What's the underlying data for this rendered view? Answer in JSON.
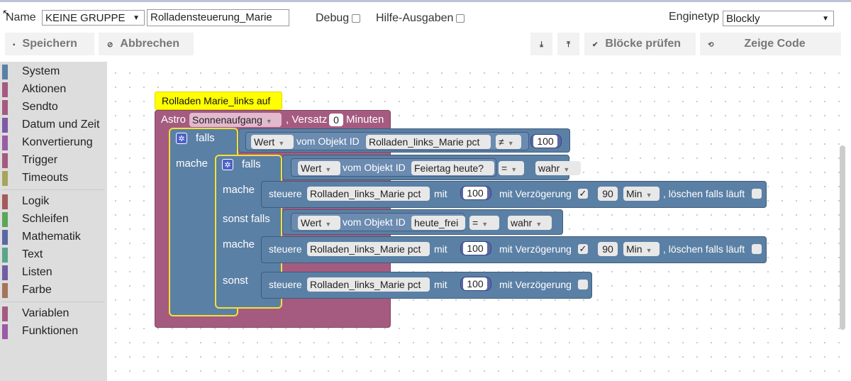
{
  "header": {
    "name_label": "Name",
    "group_select": "KEINE GRUPPE",
    "script_name": "Rolladensteuerung_Marie",
    "debug_label": "Debug",
    "help_label": "Hilfe-Ausgaben",
    "enginetype_label": "Enginetyp",
    "enginetype_value": "Blockly"
  },
  "toolbar": {
    "save_label": "Speichern",
    "cancel_label": "Abbrechen",
    "check_label": "Blöcke prüfen",
    "show_code_label": "Zeige Code"
  },
  "sidebar": {
    "items": [
      {
        "label": "System",
        "color": "#5b80a5"
      },
      {
        "label": "Aktionen",
        "color": "#a55b80"
      },
      {
        "label": "Sendto",
        "color": "#a55b80"
      },
      {
        "label": "Datum und Zeit",
        "color": "#7d5ba5"
      },
      {
        "label": "Konvertierung",
        "color": "#9a5ca6"
      },
      {
        "label": "Trigger",
        "color": "#a55b80"
      },
      {
        "label": "Timeouts",
        "color": "#a5a55b"
      },
      {
        "label": "Logik",
        "color": "#a55b5b"
      },
      {
        "label": "Schleifen",
        "color": "#5ba55b"
      },
      {
        "label": "Mathematik",
        "color": "#5b67a5"
      },
      {
        "label": "Text",
        "color": "#5ba58c"
      },
      {
        "label": "Listen",
        "color": "#745ba5"
      },
      {
        "label": "Farbe",
        "color": "#a5745b"
      },
      {
        "label": "Variablen",
        "color": "#a55b80"
      },
      {
        "label": "Funktionen",
        "color": "#995ba5"
      }
    ]
  },
  "blocks": {
    "comment": "Rolladen Marie_links auf",
    "astro_prefix": "Astro",
    "astro_event": "Sonnenaufgang",
    "astro_offset_label": ", Versatz",
    "astro_offset_value": "0",
    "astro_unit": "Minuten",
    "kw_if": "falls",
    "kw_do": "mache",
    "kw_elseif": "sonst falls",
    "kw_else": "sonst",
    "kw_value": "Wert",
    "kw_object_id": "vom Objekt ID",
    "kw_control": "steuere",
    "kw_with": "mit",
    "kw_delay": "mit Verzögerung",
    "kw_clear": ", löschen falls läuft",
    "cond1": {
      "object": "Rolladen_links_Marie pct",
      "op": "≠",
      "value": "100"
    },
    "cond2": {
      "object": "Feiertag heute?",
      "op": "=",
      "value": "wahr"
    },
    "action1": {
      "object": "Rolladen_links_Marie pct",
      "value": "100",
      "delay_checked": "✓",
      "delay": "90",
      "unit": "Min"
    },
    "cond3": {
      "object": "heute_frei",
      "op": "=",
      "value": "wahr"
    },
    "action2": {
      "object": "Rolladen_links_Marie pct",
      "value": "100",
      "delay_checked": "✓",
      "delay": "90",
      "unit": "Min"
    },
    "action3": {
      "object": "Rolladen_links_Marie pct",
      "value": "100"
    }
  }
}
